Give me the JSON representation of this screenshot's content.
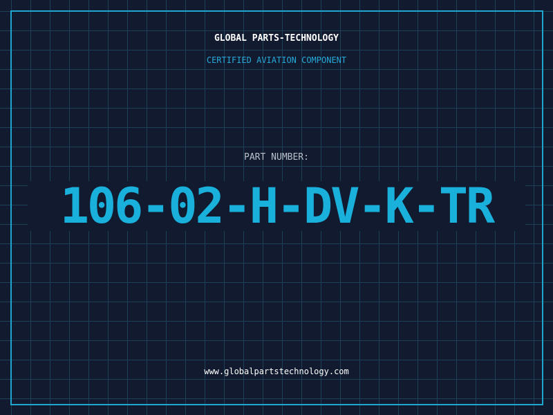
{
  "header": {
    "brand": "GLOBAL PARTS-TECHNOLOGY",
    "subtitle": "CERTIFIED AVIATION COMPONENT"
  },
  "part": {
    "label": "PART NUMBER:",
    "number": "106-02-H-DV-K-TR"
  },
  "footer": {
    "url": "www.globalpartstechnology.com"
  },
  "colors": {
    "background": "#111a2e",
    "grid": "#1e4255",
    "accent": "#1ab0dc",
    "frame": "#1ea7cf"
  }
}
